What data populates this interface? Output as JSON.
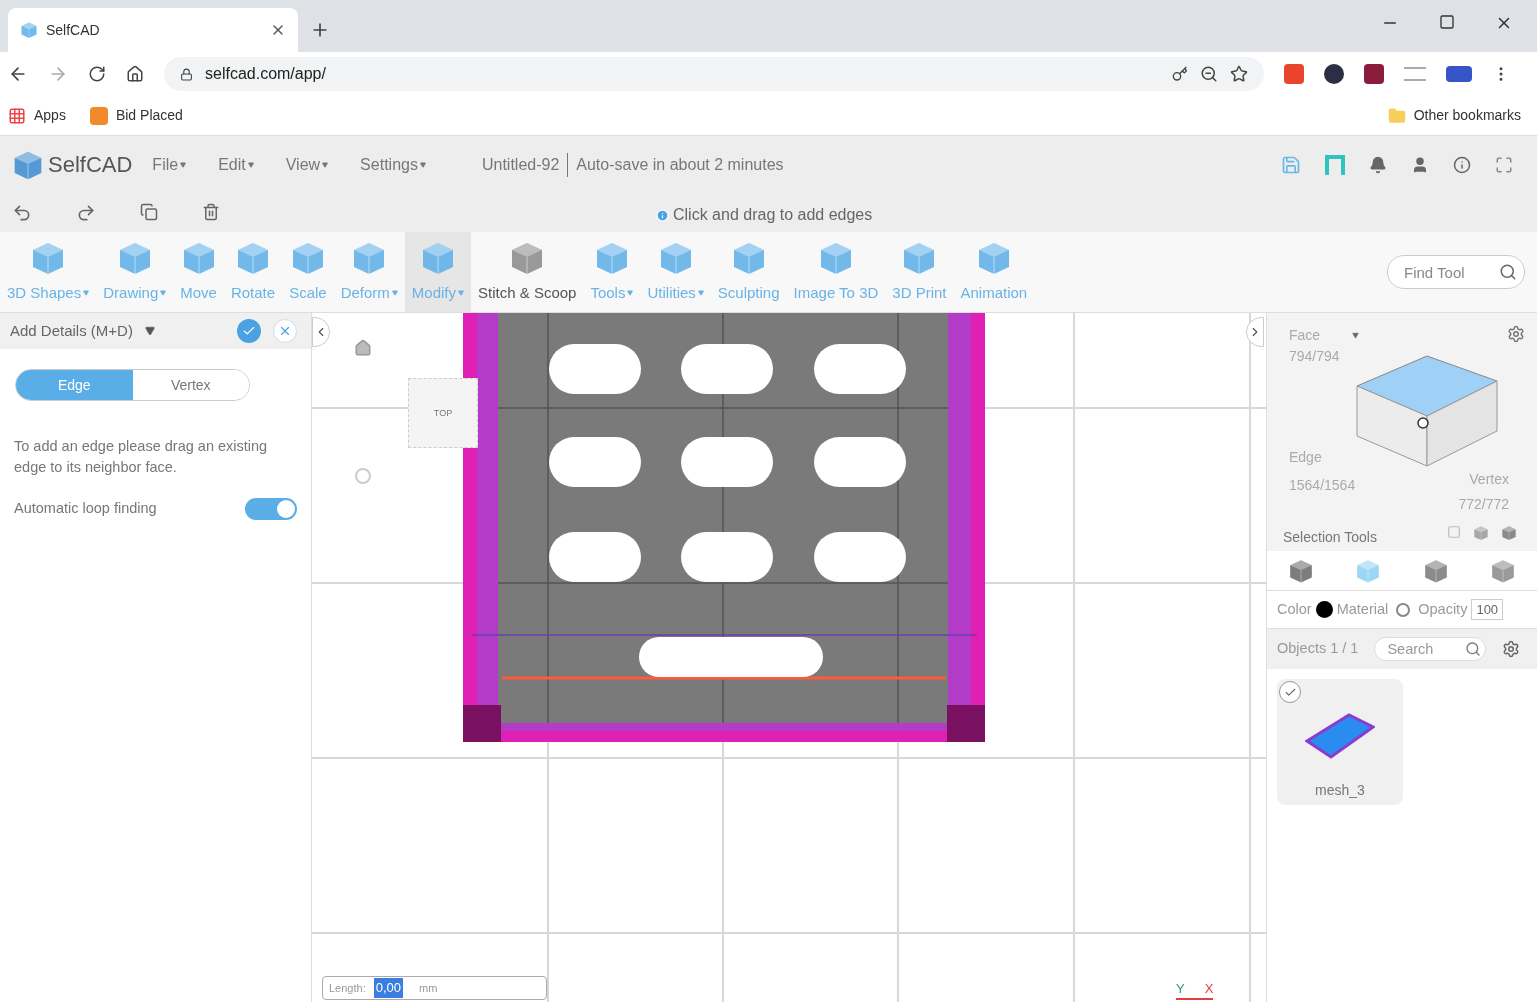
{
  "browser": {
    "tab_title": "SelfCAD",
    "url": "selfcad.com/app/",
    "bookmarks": [
      "Apps",
      "Bid Placed"
    ],
    "other_bookmarks": "Other bookmarks"
  },
  "header": {
    "logo": "SelfCAD",
    "menus": [
      "File",
      "Edit",
      "View",
      "Settings"
    ],
    "document": "Untitled-92",
    "autosave": "Auto-save in about 2 minutes"
  },
  "hint": "Click and drag to add edges",
  "tools": [
    {
      "label": "3D Shapes",
      "dropdown": true,
      "selected": false
    },
    {
      "label": "Drawing",
      "dropdown": true,
      "selected": false
    },
    {
      "label": "Move",
      "dropdown": false,
      "selected": false
    },
    {
      "label": "Rotate",
      "dropdown": false,
      "selected": false
    },
    {
      "label": "Scale",
      "dropdown": false,
      "selected": false
    },
    {
      "label": "Deform",
      "dropdown": true,
      "selected": false
    },
    {
      "label": "Modify",
      "dropdown": true,
      "selected": true
    },
    {
      "label": "Stitch & Scoop",
      "dropdown": false,
      "selected": false
    },
    {
      "label": "Tools",
      "dropdown": true,
      "selected": false
    },
    {
      "label": "Utilities",
      "dropdown": true,
      "selected": false
    },
    {
      "label": "Sculpting",
      "dropdown": false,
      "selected": false
    },
    {
      "label": "Image To 3D",
      "dropdown": false,
      "selected": false
    },
    {
      "label": "3D Print",
      "dropdown": false,
      "selected": false
    },
    {
      "label": "Animation",
      "dropdown": false,
      "selected": false
    }
  ],
  "find_tool": {
    "placeholder": "Find Tool"
  },
  "panel": {
    "title": "Add Details (M+D)",
    "modes": [
      {
        "label": "Edge",
        "selected": true
      },
      {
        "label": "Vertex",
        "selected": false
      }
    ],
    "description": "To add an edge please drag an existing edge to its neighbor face.",
    "toggle": {
      "label": "Automatic loop finding",
      "on": true
    }
  },
  "viewport": {
    "view_cube": "TOP",
    "length_label": "Length:",
    "length_value": "0,00",
    "unit": "mm",
    "axes": [
      "Y",
      "X"
    ]
  },
  "selection": {
    "face": "Face",
    "face_count": "794/794",
    "edge": "Edge",
    "edge_count": "1564/1564",
    "vertex": "Vertex",
    "vertex_count": "772/772",
    "tools_label": "Selection Tools"
  },
  "properties": {
    "color_label": "Color",
    "color": "#000000",
    "material_label": "Material",
    "opacity_label": "Opacity",
    "opacity_value": "100"
  },
  "objects": {
    "label": "Objects 1 / 1",
    "search_placeholder": "Search",
    "items": [
      {
        "name": "mesh_3",
        "checked": true
      }
    ]
  }
}
